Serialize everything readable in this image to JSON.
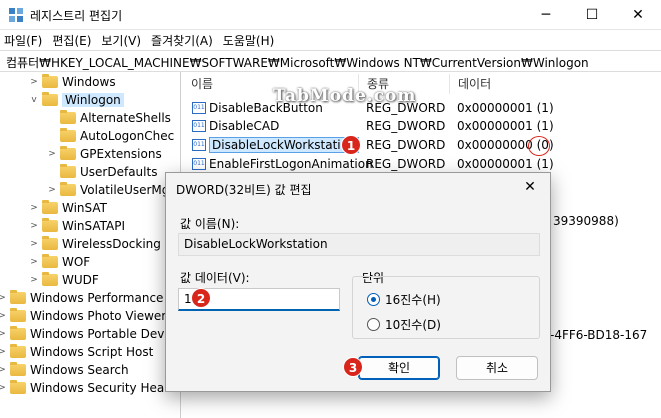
{
  "window": {
    "title": "레지스트리 편집기",
    "minimize": "─",
    "maximize": "☐",
    "close": "✕"
  },
  "menu": [
    "파일(F)",
    "편집(E)",
    "보기(V)",
    "즐겨찾기(A)",
    "도움말(H)"
  ],
  "address": "컴퓨터₩HKEY_LOCAL_MACHINE₩SOFTWARE₩Microsoft₩Windows NT₩CurrentVersion₩Winlogon",
  "tree": {
    "items": [
      {
        "label": "Windows",
        "chev": ">",
        "indent": 1
      },
      {
        "label": "Winlogon",
        "chev": "v",
        "indent": 1,
        "selected": true
      },
      {
        "label": "AlternateShells",
        "chev": "",
        "indent": 2
      },
      {
        "label": "AutoLogonChec",
        "chev": "",
        "indent": 2
      },
      {
        "label": "GPExtensions",
        "chev": ">",
        "indent": 2
      },
      {
        "label": "UserDefaults",
        "chev": "",
        "indent": 2
      },
      {
        "label": "VolatileUserMgr",
        "chev": ">",
        "indent": 2
      },
      {
        "label": "WinSAT",
        "chev": ">",
        "indent": 1
      },
      {
        "label": "WinSATAPI",
        "chev": ">",
        "indent": 1
      },
      {
        "label": "WirelessDocking",
        "chev": ">",
        "indent": 1
      },
      {
        "label": "WOF",
        "chev": ">",
        "indent": 1
      },
      {
        "label": "WUDF",
        "chev": ">",
        "indent": 1
      },
      {
        "label": "Windows Performance T",
        "chev": ">",
        "indent": 0
      },
      {
        "label": "Windows Photo Viewer",
        "chev": ">",
        "indent": 0
      },
      {
        "label": "Windows Portable Devic",
        "chev": ">",
        "indent": 0
      },
      {
        "label": "Windows Script Host",
        "chev": ">",
        "indent": 0
      },
      {
        "label": "Windows Search",
        "chev": ">",
        "indent": 0
      },
      {
        "label": "Windows Security Health",
        "chev": ">",
        "indent": 0
      }
    ]
  },
  "list": {
    "columns": [
      "이름",
      "종류",
      "데이터"
    ],
    "rows": [
      {
        "name": "DisableBackButton",
        "type": "REG_DWORD",
        "data": "0x00000001 (1)"
      },
      {
        "name": "DisableCAD",
        "type": "REG_DWORD",
        "data": "0x00000001 (1)"
      },
      {
        "name": "DisableLockWorkstation",
        "type": "REG_DWORD",
        "data": "0x00000000 (0)",
        "highlight": true
      },
      {
        "name": "EnableFirstLogonAnimation",
        "type": "REG_DWORD",
        "data": "0x00000001 (1)"
      }
    ],
    "partial_right_1": "39390988)",
    "partial_right_2": "-4FF6-BD18-167"
  },
  "watermark": "TabMode.com",
  "dialog": {
    "title": "DWORD(32비트) 값 편집",
    "close": "✕",
    "name_label": "값 이름(N):",
    "name_value": "DisableLockWorkstation",
    "data_label": "값 데이터(V):",
    "data_value": "1",
    "base_label": "단위",
    "hex_label": "16진수(H)",
    "dec_label": "10진수(D)",
    "ok_label": "확인",
    "cancel_label": "취소"
  },
  "badges": {
    "one": "1",
    "two": "2",
    "three": "3"
  },
  "colors": {
    "selection": "#cde8ff",
    "accent": "#005fb8",
    "badge": "#d9261c"
  }
}
